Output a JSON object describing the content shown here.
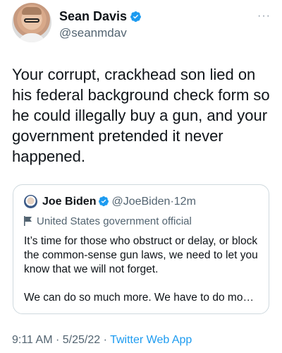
{
  "author": {
    "display_name": "Sean Davis",
    "handle": "@seanmdav",
    "verified_icon": "verified-badge-icon",
    "avatar_icon": "profile-photo"
  },
  "more_label": "···",
  "tweet_text": "Your corrupt, crackhead son lied on his federal background check form so he could illegally buy a gun, and your government pretended it never happened.",
  "quoted_tweet": {
    "display_name": "Joe Biden",
    "handle": "@JoeBiden",
    "separator": "·",
    "time": "12m",
    "label": "United States government official",
    "text": "It’s time for those who obstruct or delay, or block the common-sense gun laws, we need to let you know that we will not forget.\n\nWe can do so much more. We have to do mo…"
  },
  "footer": {
    "time": "9:11 AM",
    "sep1": "·",
    "date": "5/25/22",
    "sep2": "·",
    "source": "Twitter Web App"
  },
  "colors": {
    "verified": "#1d9bf0",
    "secondary_text": "#536471",
    "link": "#1d9bf0",
    "border": "#cfd9de"
  }
}
